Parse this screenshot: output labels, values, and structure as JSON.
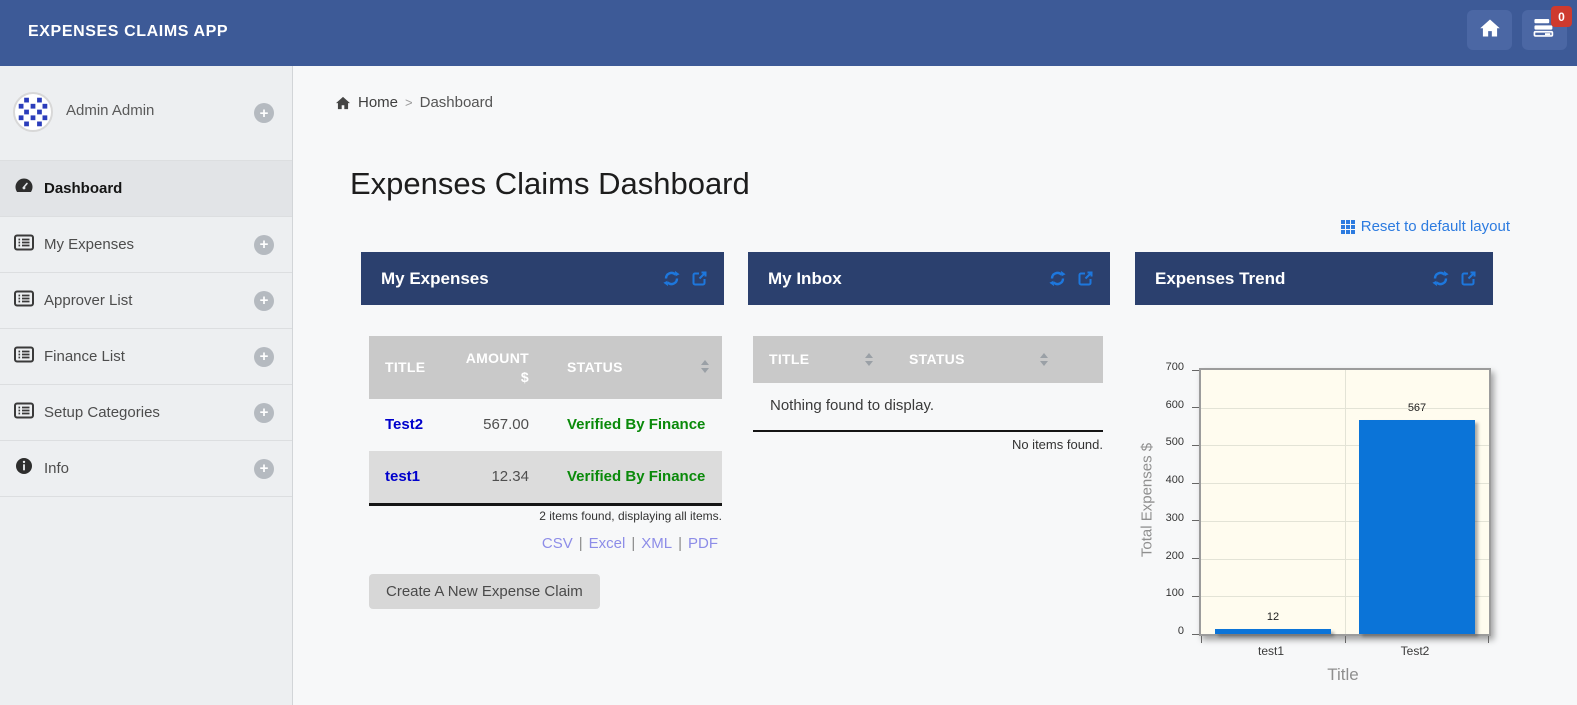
{
  "app": {
    "title": "EXPENSES CLAIMS APP",
    "badge_count": "0"
  },
  "colors": {
    "topbar": "#3d5a97",
    "panel_header": "#2b406e",
    "accent_blue": "#1d77dd",
    "link_blue": "#2c7be0",
    "row_link_blue": "#0000cc",
    "status_green": "#0a8a0a",
    "bar_blue": "#0b74d8",
    "badge_red": "#ce3a2e"
  },
  "sidebar": {
    "user_name": "Admin Admin",
    "items": [
      {
        "label": "Dashboard"
      },
      {
        "label": "My Expenses"
      },
      {
        "label": "Approver List"
      },
      {
        "label": "Finance List"
      },
      {
        "label": "Setup Categories"
      },
      {
        "label": "Info"
      }
    ]
  },
  "breadcrumb": {
    "home": "Home",
    "separator": ">",
    "current": "Dashboard"
  },
  "page": {
    "title": "Expenses Claims Dashboard",
    "reset_link": "Reset to default layout"
  },
  "panels": {
    "my_expenses": {
      "title": "My Expenses",
      "col_title": "TITLE",
      "col_amount": "AMOUNT $",
      "col_status": "STATUS",
      "rows": [
        {
          "title": "Test2",
          "amount": "567.00",
          "status": "Verified By Finance"
        },
        {
          "title": "test1",
          "amount": "12.34",
          "status": "Verified By Finance"
        }
      ],
      "summary": "2 items found, displaying all items.",
      "export_links": [
        "CSV",
        "Excel",
        "XML",
        "PDF"
      ],
      "export_separator": "|",
      "create_button": "Create A New Expense Claim"
    },
    "my_inbox": {
      "title": "My Inbox",
      "col_title": "TITLE",
      "col_status": "STATUS",
      "empty_text": "Nothing found to display.",
      "footer_text": "No items found."
    },
    "expenses_trend": {
      "title": "Expenses Trend"
    }
  },
  "chart_data": {
    "type": "bar",
    "categories": [
      "test1",
      "Test2"
    ],
    "values": [
      12,
      567
    ],
    "title": "",
    "xlabel": "Title",
    "ylabel": "Total Expenses $",
    "ylim": [
      0,
      700
    ],
    "ytick_step": 100,
    "grid": true,
    "legend": "none",
    "bar_color": "#0b74d8",
    "plot_bg": "#fffcef"
  }
}
